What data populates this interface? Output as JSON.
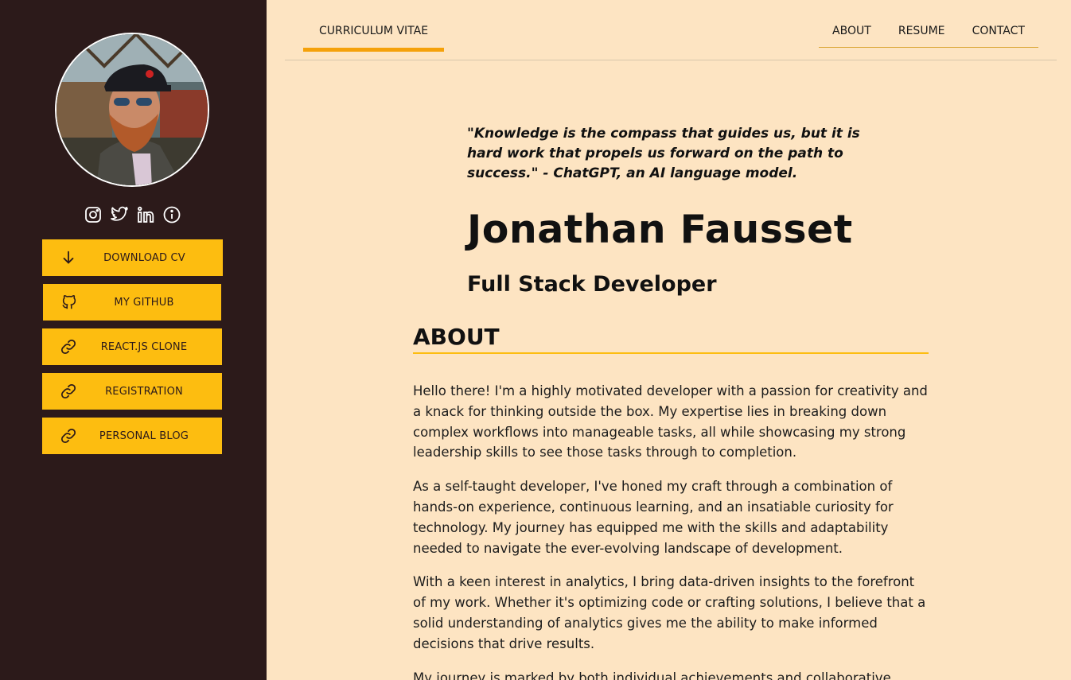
{
  "sidebar": {
    "social": [
      "instagram-icon",
      "twitter-icon",
      "linkedin-icon",
      "info-icon"
    ],
    "buttons": [
      {
        "label": "DOWNLOAD CV",
        "icon": "arrow-down-icon"
      },
      {
        "label": "MY GITHUB",
        "icon": "github-icon"
      },
      {
        "label": "REACT.JS CLONE",
        "icon": "link-icon"
      },
      {
        "label": "REGISTRATION",
        "icon": "link-icon"
      },
      {
        "label": "PERSONAL BLOG",
        "icon": "link-icon"
      }
    ]
  },
  "nav": {
    "left": "CURRICULUM VITAE",
    "right": [
      "ABOUT",
      "RESUME",
      "CONTACT"
    ]
  },
  "main": {
    "quote": "\"Knowledge is the compass that guides us, but it is hard work that propels us forward on the path to success.\" - ChatGPT, an AI language model.",
    "name": "Jonathan Fausset",
    "role": "Full Stack Developer",
    "about_heading": "ABOUT",
    "paragraphs": [
      "Hello there! I'm a highly motivated developer with a passion for creativity and a knack for thinking outside the box. My expertise lies in breaking down complex workflows into manageable tasks, all while showcasing my strong leadership skills to see those tasks through to completion.",
      "As a self-taught developer, I've honed my craft through a combination of hands-on experience, continuous learning, and an insatiable curiosity for technology. My journey has equipped me with the skills and adaptability needed to navigate the ever-evolving landscape of development.",
      "With a keen interest in analytics, I bring data-driven insights to the forefront of my work. Whether it's optimizing code or crafting solutions, I believe that a solid understanding of analytics gives me the ability to make informed decisions that drive results.",
      "My journey is marked by both individual achievements and collaborative"
    ]
  },
  "colors": {
    "sidebar_bg": "#2c1a1a",
    "accent": "#fdbd10",
    "page_bg": "#fde4c2",
    "nav_underline": "#f5a10a"
  }
}
